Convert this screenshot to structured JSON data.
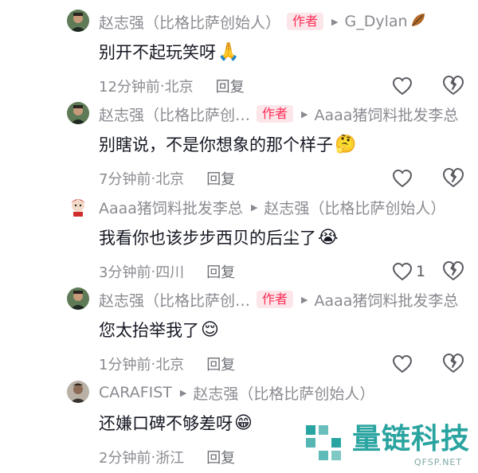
{
  "comments": [
    {
      "author": "赵志强（比格比萨创始人）",
      "author_badge": "作者",
      "reply_to": "G_Dylan",
      "reply_to_suffix_icon": "leaf-icon",
      "text": "别开不起玩笑呀",
      "emoji": "🙏",
      "time": "12分钟前",
      "location": "北京",
      "reply_label": "回复",
      "like_count": ""
    },
    {
      "author": "赵志强（比格比萨创…",
      "author_badge": "作者",
      "reply_to": "Aaaa猪饲料批发李总",
      "text": "别瞎说，不是你想象的那个样子",
      "emoji": "🤔",
      "time": "7分钟前",
      "location": "北京",
      "reply_label": "回复",
      "like_count": ""
    },
    {
      "author": "Aaaa猪饲料批发李总",
      "author_badge": "",
      "reply_to": "赵志强（比格比萨创始人）",
      "text": "我看你也该步步西贝的后尘了",
      "emoji": "😭",
      "time": "3分钟前",
      "location": "四川",
      "reply_label": "回复",
      "like_count": "1"
    },
    {
      "author": "赵志强（比格比萨创…",
      "author_badge": "作者",
      "reply_to": "Aaaa猪饲料批发李总",
      "text": "您太抬举我了",
      "emoji": "😌",
      "time": "1分钟前",
      "location": "北京",
      "reply_label": "回复",
      "like_count": ""
    },
    {
      "author": "CARAFIST",
      "author_badge": "",
      "reply_to": "赵志强（比格比萨创始人）",
      "text": "还嫌口碑不够差呀",
      "emoji": "😁",
      "time": "2分钟前",
      "location": "浙江",
      "reply_label": "回复",
      "like_count": ""
    }
  ],
  "separator": " · ",
  "watermark": {
    "title": "量链科技",
    "subtitle": "QFSP.NET"
  },
  "colors": {
    "accent": "#fe2c55",
    "muted": "#8a8b91",
    "watermark": "#2aa4a0"
  }
}
